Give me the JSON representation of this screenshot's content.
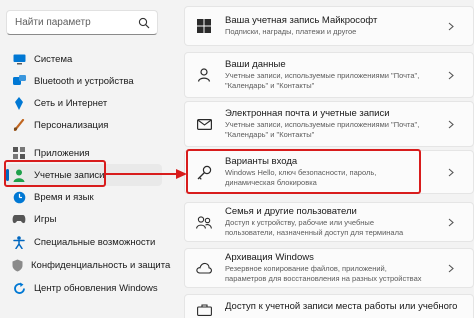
{
  "search": {
    "placeholder": "Найти параметр",
    "icon": "search-icon"
  },
  "sidebar": {
    "items": [
      {
        "label": "Система",
        "icon": "monitor-icon",
        "color": "#0078d4"
      },
      {
        "label": "Bluetooth и устройства",
        "icon": "bluetooth-icon",
        "color": "#0078d4"
      },
      {
        "label": "Сеть и Интернет",
        "icon": "wifi-icon",
        "color": "#0078d4"
      },
      {
        "label": "Персонализация",
        "icon": "brush-icon",
        "color": "#c0651f"
      },
      {
        "label": "Приложения",
        "icon": "apps-icon",
        "color": "#555555"
      },
      {
        "label": "Учетные записи",
        "icon": "person-icon",
        "color": "#1fa14b",
        "selected": true
      },
      {
        "label": "Время и язык",
        "icon": "globe-clock-icon",
        "color": "#0078d4"
      },
      {
        "label": "Игры",
        "icon": "gamepad-icon",
        "color": "#555555"
      },
      {
        "label": "Специальные возможности",
        "icon": "accessibility-icon",
        "color": "#0067c0"
      },
      {
        "label": "Конфиденциальность и защита",
        "icon": "shield-icon",
        "color": "#7a7a7a"
      },
      {
        "label": "Центр обновления Windows",
        "icon": "update-icon",
        "color": "#0078d4"
      }
    ]
  },
  "cards": [
    {
      "title": "Ваша учетная запись Майкрософт",
      "subtitle": "Подписки, награды, платежи и другое",
      "icon": "windows-logo-icon"
    },
    {
      "title": "Ваши данные",
      "subtitle": "Учетные записи, используемые приложениями \"Почта\", \"Календарь\" и \"Контакты\"",
      "icon": "person-card-icon"
    },
    {
      "title": "Электронная почта и учетные записи",
      "subtitle": "Учетные записи, используемые приложениями \"Почта\", \"Календарь\" и \"Контакты\"",
      "icon": "mail-icon"
    },
    {
      "title": "Варианты входа",
      "subtitle": "Windows Hello, ключ безопасности, пароль, динамическая блокировка",
      "icon": "key-icon"
    },
    {
      "title": "Семья и другие пользователи",
      "subtitle": "Доступ к устройству, рабочие или учебные пользователи, назначенный доступ для терминала",
      "icon": "people-icon"
    },
    {
      "title": "Архивация Windows",
      "subtitle": "Резервное копирование файлов, приложений, параметров для восстановления на разных устройствах",
      "icon": "backup-icon"
    },
    {
      "title": "Доступ к учетной записи места работы или учебного",
      "subtitle": "",
      "icon": "briefcase-icon"
    }
  ],
  "colors": {
    "highlight": "#d81c1c",
    "accent": "#0067c0"
  }
}
